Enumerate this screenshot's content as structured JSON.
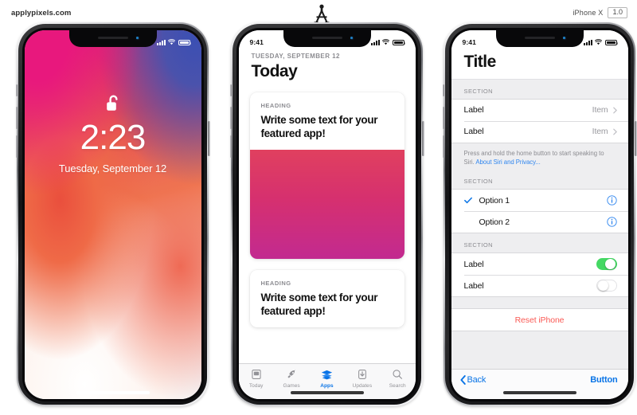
{
  "header": {
    "brand": "applypixels.com",
    "logo_icon": "compass-divider-icon",
    "device_name": "iPhone X",
    "device_version": "1.0"
  },
  "phone_lock": {
    "statusbar": {
      "time": "",
      "signal_icon": "cellular-signal-icon",
      "wifi_icon": "wifi-icon",
      "battery_icon": "battery-full-icon"
    },
    "lock_icon": "unlocked-padlock-icon",
    "time": "2:23",
    "date": "Tuesday, September 12"
  },
  "phone_today": {
    "statusbar": {
      "time": "9:41",
      "signal_icon": "cellular-signal-icon",
      "wifi_icon": "wifi-icon",
      "battery_icon": "battery-full-icon"
    },
    "date": "TUESDAY, SEPTEMBER 12",
    "title": "Today",
    "cards": [
      {
        "heading": "HEADING",
        "title": "Write some text for your featured app!",
        "has_image": true
      },
      {
        "heading": "HEADING",
        "title": "Write some text for your featured app!",
        "has_image": false
      }
    ],
    "tabs": [
      {
        "label": "Today",
        "icon": "today-document-icon",
        "active": false
      },
      {
        "label": "Games",
        "icon": "rocket-icon",
        "active": false
      },
      {
        "label": "Apps",
        "icon": "apps-stack-icon",
        "active": true
      },
      {
        "label": "Updates",
        "icon": "download-arrow-icon",
        "active": false
      },
      {
        "label": "Search",
        "icon": "search-icon",
        "active": false
      }
    ],
    "accent_color": "#0a74e6"
  },
  "phone_settings": {
    "statusbar": {
      "time": "9:41",
      "signal_icon": "cellular-signal-icon",
      "wifi_icon": "wifi-icon",
      "battery_icon": "battery-full-icon"
    },
    "title": "Title",
    "section_1": {
      "label": "SECTION",
      "rows": [
        {
          "label": "Label",
          "value": "Item",
          "accessory": "chevron-right-icon"
        },
        {
          "label": "Label",
          "value": "Item",
          "accessory": "chevron-right-icon"
        }
      ],
      "footer_text": "Press and hold the home button to start speaking to Siri. ",
      "footer_link": "About Siri and Privacy..."
    },
    "section_2": {
      "label": "SECTION",
      "options": [
        {
          "label": "Option 1",
          "selected": true,
          "accessory": "info-circle-icon"
        },
        {
          "label": "Option 2",
          "selected": false,
          "accessory": "info-circle-icon"
        }
      ]
    },
    "section_3": {
      "label": "SECTION",
      "toggles": [
        {
          "label": "Label",
          "on": true
        },
        {
          "label": "Label",
          "on": false
        }
      ]
    },
    "destructive_action": "Reset iPhone",
    "toolbar": {
      "back_label": "Back",
      "back_icon": "chevron-left-icon",
      "button_label": "Button"
    },
    "accent_color": "#0a74e6",
    "destructive_color": "#fa5a55",
    "toggle_on_color": "#44d863"
  }
}
